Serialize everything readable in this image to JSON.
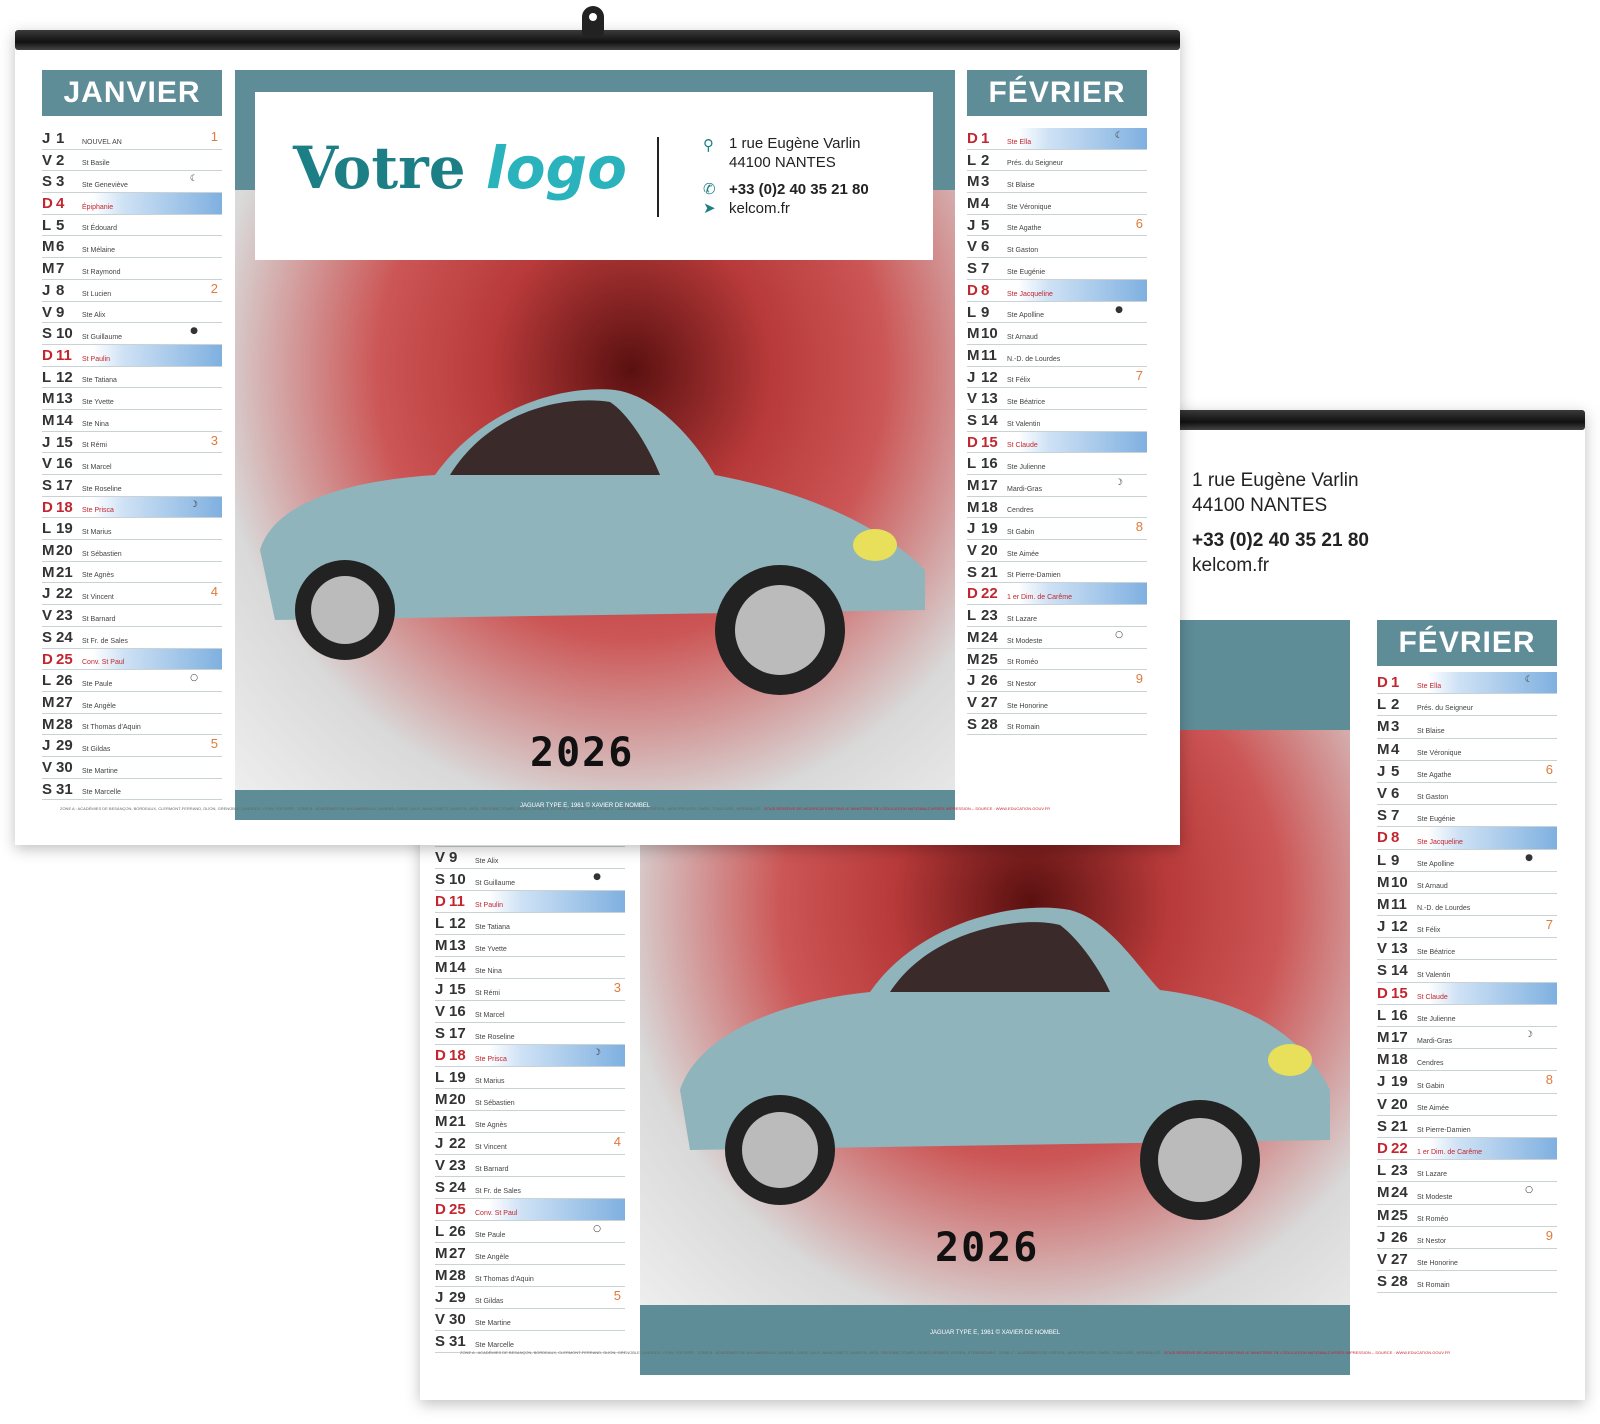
{
  "brand": {
    "logo_main": "Votre",
    "logo_italic": "logo",
    "address_line1": "1 rue Eugène Varlin",
    "address_line2": "44100 NANTES",
    "phone": "+33 (0)2 40 35 21 80",
    "website": "kelcom.fr"
  },
  "year": "2026",
  "photo_credit": "JAGUAR TYPE E, 1961 © XAVIER DE NOMBEL",
  "footer": {
    "zone_a": "ZONE A : ACADÉMIES DE BESANÇON, BORDEAUX, CLERMONT-FERRAND, DIJON, GRENOBLE, LIMOGES, LYON, POITIERS",
    "zone_b": "ZONE B : ACADÉMIES DE AIX-MARSEILLE, AMIENS, CAEN, LILLE, NANCY-METZ, NANTES, NICE, ORLÉANS-TOURS, REIMS, RENNES, ROUEN, STRASBOURG",
    "zone_c": "ZONE C : ACADÉMIES DE CRÉTEIL, MONTPELLIER, PARIS, TOULOUSE, VERSAILLES",
    "notice": "SOUS RÉSERVE DE MODIFICATIONS PAR LE MINISTÈRE DE L'ÉDUCATION NATIONALE APRÈS IMPRESSION – SOURCE : WWW.EDUCATION.GOUV.FR"
  },
  "months": {
    "janvier": {
      "name": "JANVIER",
      "days": [
        {
          "l": "J",
          "n": "1",
          "s": "NOUVEL AN",
          "w": "1",
          "m": ""
        },
        {
          "l": "V",
          "n": "2",
          "s": "St Basile",
          "w": "",
          "m": ""
        },
        {
          "l": "S",
          "n": "3",
          "s": "Ste Geneviève",
          "w": "",
          "m": "☾"
        },
        {
          "l": "D",
          "n": "4",
          "s": "Épiphanie",
          "w": "",
          "m": ""
        },
        {
          "l": "L",
          "n": "5",
          "s": "St Édouard",
          "w": "",
          "m": ""
        },
        {
          "l": "M",
          "n": "6",
          "s": "St Mélaine",
          "w": "",
          "m": ""
        },
        {
          "l": "M",
          "n": "7",
          "s": "St Raymond",
          "w": "",
          "m": ""
        },
        {
          "l": "J",
          "n": "8",
          "s": "St Lucien",
          "w": "2",
          "m": ""
        },
        {
          "l": "V",
          "n": "9",
          "s": "Ste Alix",
          "w": "",
          "m": ""
        },
        {
          "l": "S",
          "n": "10",
          "s": "St Guillaume",
          "w": "",
          "m": "●"
        },
        {
          "l": "D",
          "n": "11",
          "s": "St Paulin",
          "w": "",
          "m": ""
        },
        {
          "l": "L",
          "n": "12",
          "s": "Ste Tatiana",
          "w": "",
          "m": ""
        },
        {
          "l": "M",
          "n": "13",
          "s": "Ste Yvette",
          "w": "",
          "m": ""
        },
        {
          "l": "M",
          "n": "14",
          "s": "Ste Nina",
          "w": "",
          "m": ""
        },
        {
          "l": "J",
          "n": "15",
          "s": "St Rémi",
          "w": "3",
          "m": ""
        },
        {
          "l": "V",
          "n": "16",
          "s": "St Marcel",
          "w": "",
          "m": ""
        },
        {
          "l": "S",
          "n": "17",
          "s": "Ste Roseline",
          "w": "",
          "m": ""
        },
        {
          "l": "D",
          "n": "18",
          "s": "Ste Prisca",
          "w": "",
          "m": "☽"
        },
        {
          "l": "L",
          "n": "19",
          "s": "St Marius",
          "w": "",
          "m": ""
        },
        {
          "l": "M",
          "n": "20",
          "s": "St Sébastien",
          "w": "",
          "m": ""
        },
        {
          "l": "M",
          "n": "21",
          "s": "Ste Agnès",
          "w": "",
          "m": ""
        },
        {
          "l": "J",
          "n": "22",
          "s": "St Vincent",
          "w": "4",
          "m": ""
        },
        {
          "l": "V",
          "n": "23",
          "s": "St Barnard",
          "w": "",
          "m": ""
        },
        {
          "l": "S",
          "n": "24",
          "s": "St Fr. de Sales",
          "w": "",
          "m": ""
        },
        {
          "l": "D",
          "n": "25",
          "s": "Conv. St Paul",
          "w": "",
          "m": ""
        },
        {
          "l": "L",
          "n": "26",
          "s": "Ste Paule",
          "w": "",
          "m": "○"
        },
        {
          "l": "M",
          "n": "27",
          "s": "Ste Angèle",
          "w": "",
          "m": ""
        },
        {
          "l": "M",
          "n": "28",
          "s": "St Thomas d'Aquin",
          "w": "",
          "m": ""
        },
        {
          "l": "J",
          "n": "29",
          "s": "St Gildas",
          "w": "5",
          "m": ""
        },
        {
          "l": "V",
          "n": "30",
          "s": "Ste Martine",
          "w": "",
          "m": ""
        },
        {
          "l": "S",
          "n": "31",
          "s": "Ste Marcelle",
          "w": "",
          "m": ""
        }
      ]
    },
    "fevrier": {
      "name": "FÉVRIER",
      "days": [
        {
          "l": "D",
          "n": "1",
          "s": "Ste Ella",
          "w": "",
          "m": "☾"
        },
        {
          "l": "L",
          "n": "2",
          "s": "Prés. du Seigneur",
          "w": "",
          "m": ""
        },
        {
          "l": "M",
          "n": "3",
          "s": "St Blaise",
          "w": "",
          "m": ""
        },
        {
          "l": "M",
          "n": "4",
          "s": "Ste Véronique",
          "w": "",
          "m": ""
        },
        {
          "l": "J",
          "n": "5",
          "s": "Ste Agathe",
          "w": "6",
          "m": ""
        },
        {
          "l": "V",
          "n": "6",
          "s": "St Gaston",
          "w": "",
          "m": ""
        },
        {
          "l": "S",
          "n": "7",
          "s": "Ste Eugénie",
          "w": "",
          "m": ""
        },
        {
          "l": "D",
          "n": "8",
          "s": "Ste Jacqueline",
          "w": "",
          "m": ""
        },
        {
          "l": "L",
          "n": "9",
          "s": "Ste Apolline",
          "w": "",
          "m": "●"
        },
        {
          "l": "M",
          "n": "10",
          "s": "St Arnaud",
          "w": "",
          "m": ""
        },
        {
          "l": "M",
          "n": "11",
          "s": "N.-D. de Lourdes",
          "w": "",
          "m": ""
        },
        {
          "l": "J",
          "n": "12",
          "s": "St Félix",
          "w": "7",
          "m": ""
        },
        {
          "l": "V",
          "n": "13",
          "s": "Ste Béatrice",
          "w": "",
          "m": ""
        },
        {
          "l": "S",
          "n": "14",
          "s": "St Valentin",
          "w": "",
          "m": ""
        },
        {
          "l": "D",
          "n": "15",
          "s": "St Claude",
          "w": "",
          "m": ""
        },
        {
          "l": "L",
          "n": "16",
          "s": "Ste Julienne",
          "w": "",
          "m": ""
        },
        {
          "l": "M",
          "n": "17",
          "s": "Mardi-Gras",
          "w": "",
          "m": "☽"
        },
        {
          "l": "M",
          "n": "18",
          "s": "Cendres",
          "w": "",
          "m": ""
        },
        {
          "l": "J",
          "n": "19",
          "s": "St Gabin",
          "w": "8",
          "m": ""
        },
        {
          "l": "V",
          "n": "20",
          "s": "Ste Aimée",
          "w": "",
          "m": ""
        },
        {
          "l": "S",
          "n": "21",
          "s": "St Pierre-Damien",
          "w": "",
          "m": ""
        },
        {
          "l": "D",
          "n": "22",
          "s": "1 er Dim. de Carême",
          "w": "",
          "m": ""
        },
        {
          "l": "L",
          "n": "23",
          "s": "St Lazare",
          "w": "",
          "m": ""
        },
        {
          "l": "M",
          "n": "24",
          "s": "St Modeste",
          "w": "",
          "m": "○"
        },
        {
          "l": "M",
          "n": "25",
          "s": "St Roméo",
          "w": "",
          "m": ""
        },
        {
          "l": "J",
          "n": "26",
          "s": "St Nestor",
          "w": "9",
          "m": ""
        },
        {
          "l": "V",
          "n": "27",
          "s": "Ste Honorine",
          "w": "",
          "m": ""
        },
        {
          "l": "S",
          "n": "28",
          "s": "St Romain",
          "w": "",
          "m": ""
        }
      ]
    }
  },
  "colors": {
    "teal": "#5e8c97",
    "sunday_red": "#c2262e",
    "week_orange": "#e07a3c",
    "logo_dark": "#1d7f86",
    "logo_light": "#2ab3bd"
  },
  "icons": [
    "location-pin-icon",
    "phone-icon",
    "cursor-icon",
    "hanging-hook-icon"
  ]
}
